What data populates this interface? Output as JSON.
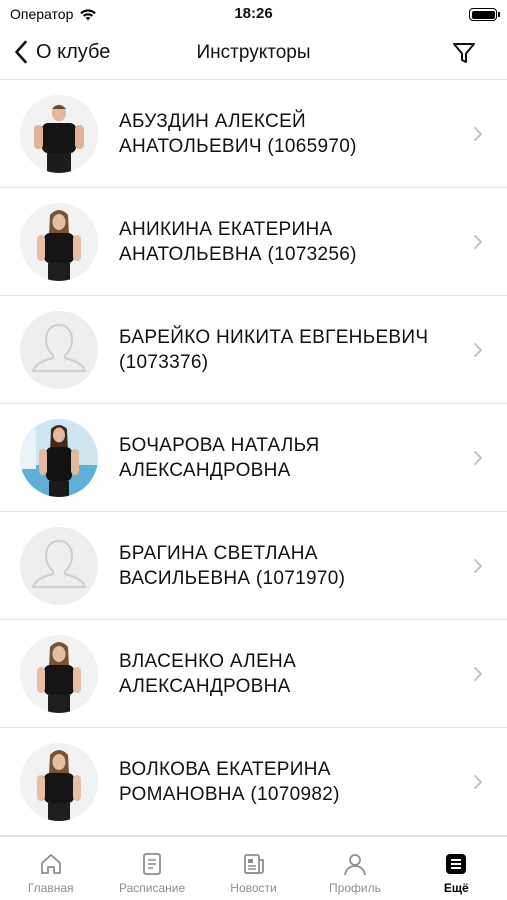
{
  "status_bar": {
    "carrier": "Оператор",
    "time": "18:26"
  },
  "nav": {
    "back_label": "О клубе",
    "title": "Инструкторы"
  },
  "instructors": [
    {
      "name": "АБУЗДИН АЛЕКСЕЙ АНАТОЛЬЕВИЧ (1065970)",
      "photo": "male-photo"
    },
    {
      "name": "АНИКИНА ЕКАТЕРИНА АНАТОЛЬЕВНА (1073256)",
      "photo": "female-photo"
    },
    {
      "name": "БАРЕЙКО НИКИТА ЕВГЕНЬЕВИЧ (1073376)",
      "photo": "placeholder"
    },
    {
      "name": "БОЧАРОВА НАТАЛЬЯ АЛЕКСАНДРОВНА",
      "photo": "female-photo-pool"
    },
    {
      "name": "БРАГИНА СВЕТЛАНА ВАСИЛЬЕВНА (1071970)",
      "photo": "placeholder"
    },
    {
      "name": "ВЛАСЕНКО АЛЕНА АЛЕКСАНДРОВНА",
      "photo": "female-photo"
    },
    {
      "name": "ВОЛКОВА ЕКАТЕРИНА РОМАНОВНА (1070982)",
      "photo": "female-photo"
    }
  ],
  "tabs": [
    {
      "label": "Главная",
      "icon": "home-icon",
      "active": false
    },
    {
      "label": "Расписание",
      "icon": "schedule-icon",
      "active": false
    },
    {
      "label": "Новости",
      "icon": "news-icon",
      "active": false
    },
    {
      "label": "Профиль",
      "icon": "profile-icon",
      "active": false
    },
    {
      "label": "Ещё",
      "icon": "more-icon",
      "active": true
    }
  ],
  "colors": {
    "accent": "#000000",
    "inactive": "#8e8e8e",
    "divider": "#e6e6e6"
  }
}
